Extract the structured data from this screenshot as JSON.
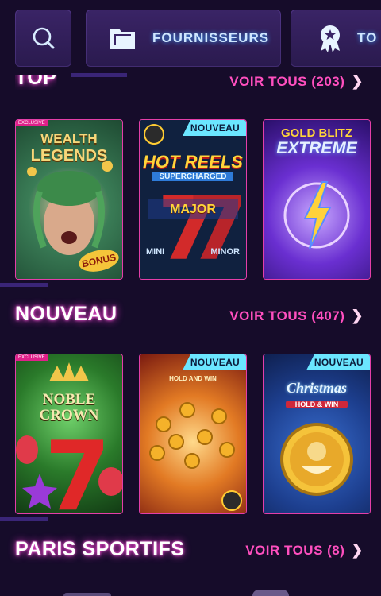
{
  "nav": {
    "providers_label": "FOURNISSEURS",
    "tournaments_label": "TO"
  },
  "sections": {
    "top": {
      "title": "TOP",
      "see_all": "VOIR TOUS (203)"
    },
    "new": {
      "title": "NOUVEAU",
      "see_all": "VOIR TOUS (407)"
    },
    "sports": {
      "title": "PARIS SPORTIFS",
      "see_all": "VOIR TOUS (8)"
    }
  },
  "games": {
    "top": [
      {
        "title_line1": "WEALTH",
        "title_line2": "LEGENDS",
        "tag": "EXCLUSIVE",
        "sticker": "BONUS"
      },
      {
        "badge": "NOUVEAU",
        "title_line1": "HOT REELS",
        "title_line2": "SUPERCHARGED",
        "jackpot_major": "MAJOR",
        "jackpot_mini": "MINI",
        "jackpot_minor": "MINOR"
      },
      {
        "title_line1": "GOLD BLITZ",
        "title_line2": "EXTREME"
      }
    ],
    "new": [
      {
        "title_line1": "NOBLE",
        "title_line2": "CROWN",
        "tag": "EXCLUSIVE"
      },
      {
        "badge": "NOUVEAU",
        "subtitle": "HOLD AND WIN"
      },
      {
        "badge": "NOUVEAU",
        "title_line1": "Christmas",
        "subtitle": "HOLD & WIN"
      }
    ]
  },
  "colors": {
    "background": "#160c2a",
    "accent_pink": "#ff4fbf",
    "badge_cyan": "#6be6ff"
  }
}
